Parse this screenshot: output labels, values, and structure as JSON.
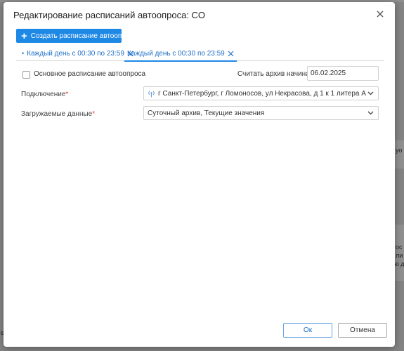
{
  "dialog": {
    "title": "Редактирование расписаний автоопроса: CO",
    "create_button": "Создать расписание автоопроса",
    "tabs": [
      {
        "label": "Каждый день с 00:30 по 23:59",
        "active": false,
        "marker": "•"
      },
      {
        "label": "Каждый день с 00:30 по 23:59",
        "active": true
      }
    ],
    "main_schedule_label": "Основное расписание автоопроса",
    "main_schedule_checked": false,
    "archive_start_label": "Считать архив начиная с",
    "archive_start_value": "06.02.2025",
    "connection_label": "Подключение",
    "connection_value": "г Санкт-Петербург, г Ломоносов, ул Некрасова, д 1 к 1 литера А",
    "loaded_data_label": "Загружаемые данные",
    "loaded_data_value": "Суточный архив, Текущие значения",
    "required_mark": "*",
    "ok_button": "Ок",
    "cancel_button": "Отмена"
  },
  "background": {
    "fragments": [
      "уо",
      "ос",
      "ли",
      "ю д",
      "е"
    ]
  },
  "colors": {
    "accent": "#1e88e5",
    "tab_text": "#1e6fc8",
    "required": "#e53935"
  },
  "icons": {
    "close": "close-icon",
    "plus": "plus-icon",
    "tab_close": "x-icon",
    "antenna": "antenna-icon",
    "chevron": "chevron-down-icon"
  }
}
